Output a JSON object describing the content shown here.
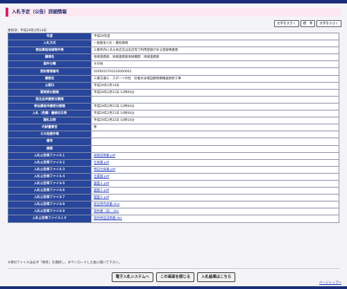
{
  "page_title": "入札予定（公告）詳細情報",
  "font_buttons": [
    "文字を大きく",
    "標　準",
    "文字を小さく"
  ],
  "updated": "更新日：平成29年2月14日",
  "rows": [
    {
      "label": "年度",
      "value": "平成29年度"
    },
    {
      "label": "入札方式",
      "value": "一般競争入札・最低価格"
    },
    {
      "label": "参加資格地域等件等",
      "value": "三重県内にある本店又は支店等で利用登録がある登録事業者"
    },
    {
      "label": "調達名",
      "value": "地域連携部、地域連携部地域機関　地域連携部"
    },
    {
      "label": "案件分類",
      "value": "その他"
    },
    {
      "label": "契約管理番号",
      "value": "0200010793310000002"
    },
    {
      "label": "業務名",
      "value": "三重交通Ｇ　スポーツの杜　鈴鹿水泳場自動制御機器更新工事"
    },
    {
      "label": "公開日",
      "value": "平成29年2月14日"
    },
    {
      "label": "質問受付期限",
      "value": "平成29年2月21日 12時00分"
    },
    {
      "label": "発注品申請受付期限",
      "value": ""
    },
    {
      "label": "参加資格申請受付期限",
      "value": "平成29年2月21日 12時00分"
    },
    {
      "label": "入札（見積）書締切日時",
      "value": "平成29年2月21日 10時00分"
    },
    {
      "label": "開札日時",
      "value": "平成29年2月22日 10時10分"
    },
    {
      "label": "内訳書要否",
      "value": "要"
    },
    {
      "label": "その他要件等",
      "value": ""
    },
    {
      "label": "備考",
      "value": ""
    },
    {
      "label": "摘要",
      "value": ""
    }
  ],
  "files": [
    {
      "label": "入札公告等ファイル１",
      "value": "調達説明書.pdf"
    },
    {
      "label": "入札公告等ファイル２",
      "value": "仕様書.pdf"
    },
    {
      "label": "入札公告等ファイル３",
      "value": "特記仕様書.pdf"
    },
    {
      "label": "入札公告等ファイル４",
      "value": "位置図.pdf"
    },
    {
      "label": "入札公告等ファイル５",
      "value": "図面１.pdf"
    },
    {
      "label": "入札公告等ファイル６",
      "value": "図面２.pdf"
    },
    {
      "label": "入札公告等ファイル７",
      "value": "図面３.pdf"
    },
    {
      "label": "入札公告等ファイル８",
      "value": "提出用内訳書.xlsx"
    },
    {
      "label": "入札公告等ファイル９",
      "value": "契約書（案）.doc"
    },
    {
      "label": "入札公告等ファイル１０",
      "value": "契約保証証明書.doc"
    }
  ],
  "note": "※添付ファイルは必ず「保存」を選択し、ダウンロードした後に開いて下さい。",
  "bottom_buttons": [
    "電子入札システムへ",
    "この画面を閉じる",
    "入札結果はこちら"
  ],
  "page_top": "ページトップへ"
}
